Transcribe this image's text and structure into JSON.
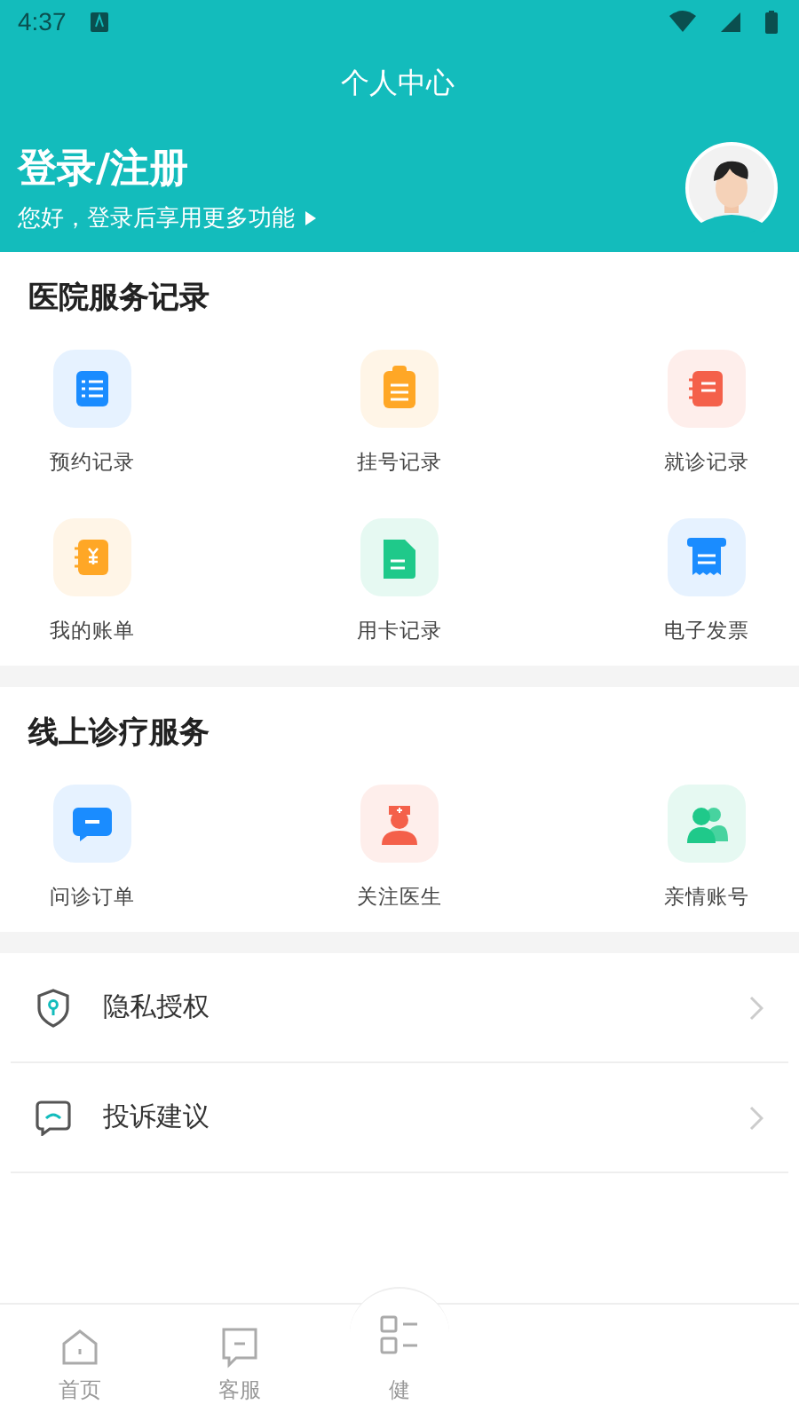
{
  "status_bar": {
    "time": "4:37"
  },
  "header": {
    "title": "个人中心",
    "login": "登录/注册",
    "subtitle": "您好，登录后享用更多功能"
  },
  "sections": [
    {
      "title": "医院服务记录",
      "items": [
        {
          "label": "预约记录",
          "kind": "list",
          "color": "#1a8cff"
        },
        {
          "label": "挂号记录",
          "kind": "clipboard",
          "color": "#ffa726"
        },
        {
          "label": "就诊记录",
          "kind": "notebook",
          "color": "#f4604a"
        },
        {
          "label": "我的账单",
          "kind": "bill",
          "color": "#ffa726"
        },
        {
          "label": "用卡记录",
          "kind": "document",
          "color": "#1fc98a"
        },
        {
          "label": "电子发票",
          "kind": "invoice",
          "color": "#1a8cff"
        }
      ]
    },
    {
      "title": "线上诊疗服务",
      "items": [
        {
          "label": "问诊订单",
          "kind": "chat",
          "color": "#1a8cff"
        },
        {
          "label": "关注医生",
          "kind": "doctor",
          "color": "#f4604a"
        },
        {
          "label": "亲情账号",
          "kind": "people",
          "color": "#1fc98a"
        }
      ]
    }
  ],
  "menu": [
    {
      "label": "隐私授权",
      "kind": "shield"
    },
    {
      "label": "投诉建议",
      "kind": "feedback"
    }
  ],
  "tab_bar": [
    {
      "label": "首页",
      "kind": "home",
      "selected": false
    },
    {
      "label": "客服",
      "kind": "service",
      "selected": false
    },
    {
      "label": "健",
      "kind": "health",
      "selected": false
    }
  ]
}
